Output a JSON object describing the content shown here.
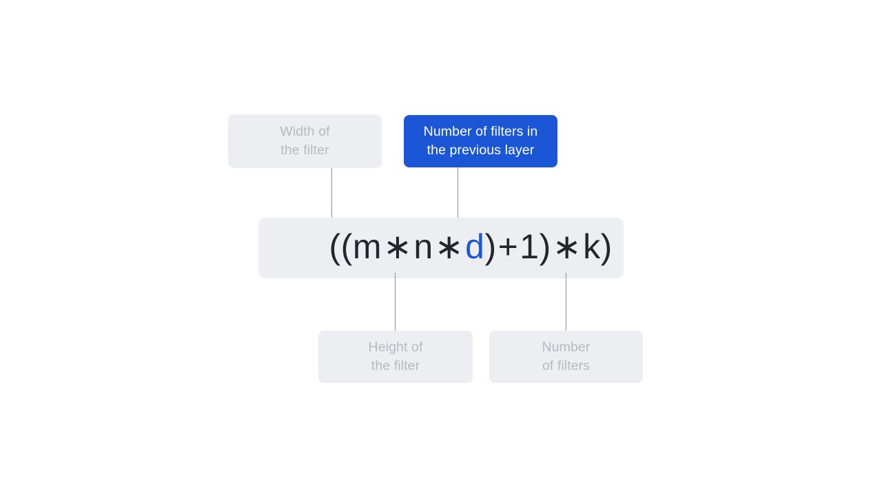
{
  "diagram": {
    "title": "CNN parameter-count formula annotated diagram",
    "background_color": "#ffffff",
    "formula": {
      "full_text": "((m ∗ n ∗ d) + 1) ∗ k)",
      "parts": {
        "open_parens": "((",
        "m": "m",
        "op1": "∗",
        "n": "n",
        "op2": "∗",
        "d": "d",
        "close_d": ")",
        "plus": "+",
        "one": "1",
        "close_inner": ")",
        "op3": "∗",
        "k": "k",
        "close_outer": ")"
      },
      "highlight_symbol": "d",
      "highlight_color": "#1a56d6",
      "text_color": "#23262b",
      "box_color": "#eceef1"
    },
    "callouts": [
      {
        "id": "width",
        "label": "Width of\nthe filter",
        "symbol": "m",
        "state": "muted",
        "background": "#eceef1",
        "text_color": "#b6b9be",
        "position": "top-left"
      },
      {
        "id": "depth",
        "label": "Number of filters in\nthe previous layer",
        "symbol": "d",
        "state": "highlighted",
        "background": "#1a56d6",
        "text_color": "#ffffff",
        "position": "top-right"
      },
      {
        "id": "height",
        "label": "Height of\nthe filter",
        "symbol": "n",
        "state": "muted",
        "background": "#eceef1",
        "text_color": "#b6b9be",
        "position": "bottom-left"
      },
      {
        "id": "num_filters",
        "label": "Number\nof filters",
        "symbol": "k",
        "state": "muted",
        "background": "#eceef1",
        "text_color": "#b6b9be",
        "position": "bottom-right"
      }
    ],
    "connectors": {
      "color": "#8d9096",
      "count": 4
    }
  }
}
